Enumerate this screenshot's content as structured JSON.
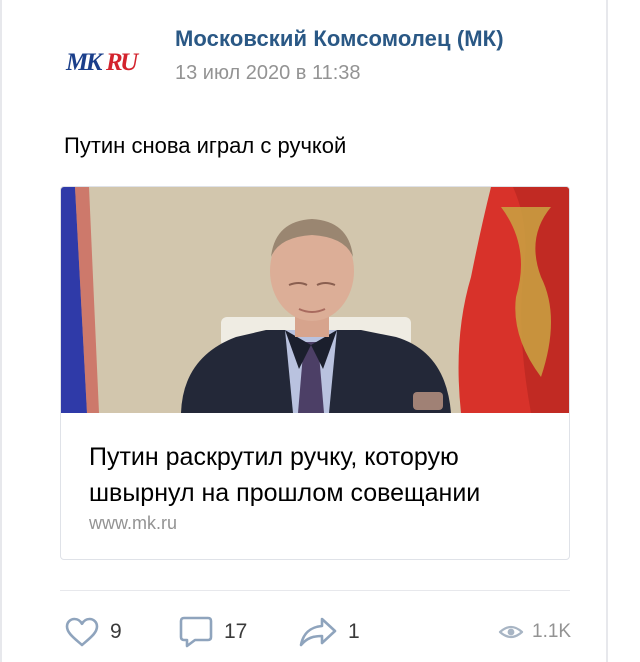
{
  "post": {
    "author": "Московский Комсомолец (МК)",
    "date": "13 июл 2020 в 11:38",
    "logo_text": "MKRU",
    "text": "Путин снова играл с ручкой"
  },
  "attachment": {
    "title": "Путин раскрутил ручку, которую швырнул на прошлом совещании",
    "domain": "www.mk.ru"
  },
  "actions": {
    "likes": "9",
    "comments": "17",
    "shares": "1",
    "views": "1.1K"
  },
  "colors": {
    "link": "#2a5885",
    "secondary": "#939393",
    "icon": "#8fa4bd",
    "divider": "#e7e8ec",
    "logo_red": "#d3232d",
    "logo_blue": "#1b3f8b"
  },
  "icons": {
    "like": "heart-outline-icon",
    "comment": "speech-bubble-icon",
    "share": "share-arrow-icon",
    "views": "eye-icon"
  }
}
